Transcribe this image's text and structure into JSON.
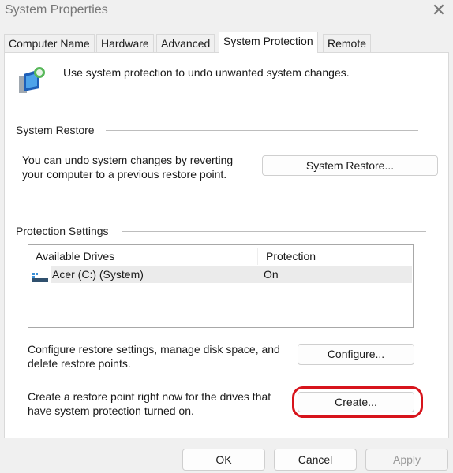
{
  "window": {
    "title": "System Properties",
    "close_icon": "close-icon"
  },
  "tabs": [
    {
      "label": "Computer Name",
      "active": false
    },
    {
      "label": "Hardware",
      "active": false
    },
    {
      "label": "Advanced",
      "active": false
    },
    {
      "label": "System Protection",
      "active": true
    },
    {
      "label": "Remote",
      "active": false
    }
  ],
  "intro": {
    "text": "Use system protection to undo unwanted system changes.",
    "icon": "system-protection-icon"
  },
  "system_restore": {
    "heading": "System Restore",
    "description": "You can undo system changes by reverting your computer to a previous restore point.",
    "button": "System Restore..."
  },
  "protection": {
    "heading": "Protection Settings",
    "columns": [
      "Available Drives",
      "Protection"
    ],
    "drives": [
      {
        "name": "Acer (C:) (System)",
        "protection": "On",
        "icon": "drive-icon"
      }
    ],
    "configure_text": "Configure restore settings, manage disk space, and delete restore points.",
    "configure_button": "Configure...",
    "create_text": "Create a restore point right now for the drives that have system protection turned on.",
    "create_button": "Create...",
    "highlight_color": "#d7141c"
  },
  "footer": {
    "ok": "OK",
    "cancel": "Cancel",
    "apply": "Apply"
  }
}
